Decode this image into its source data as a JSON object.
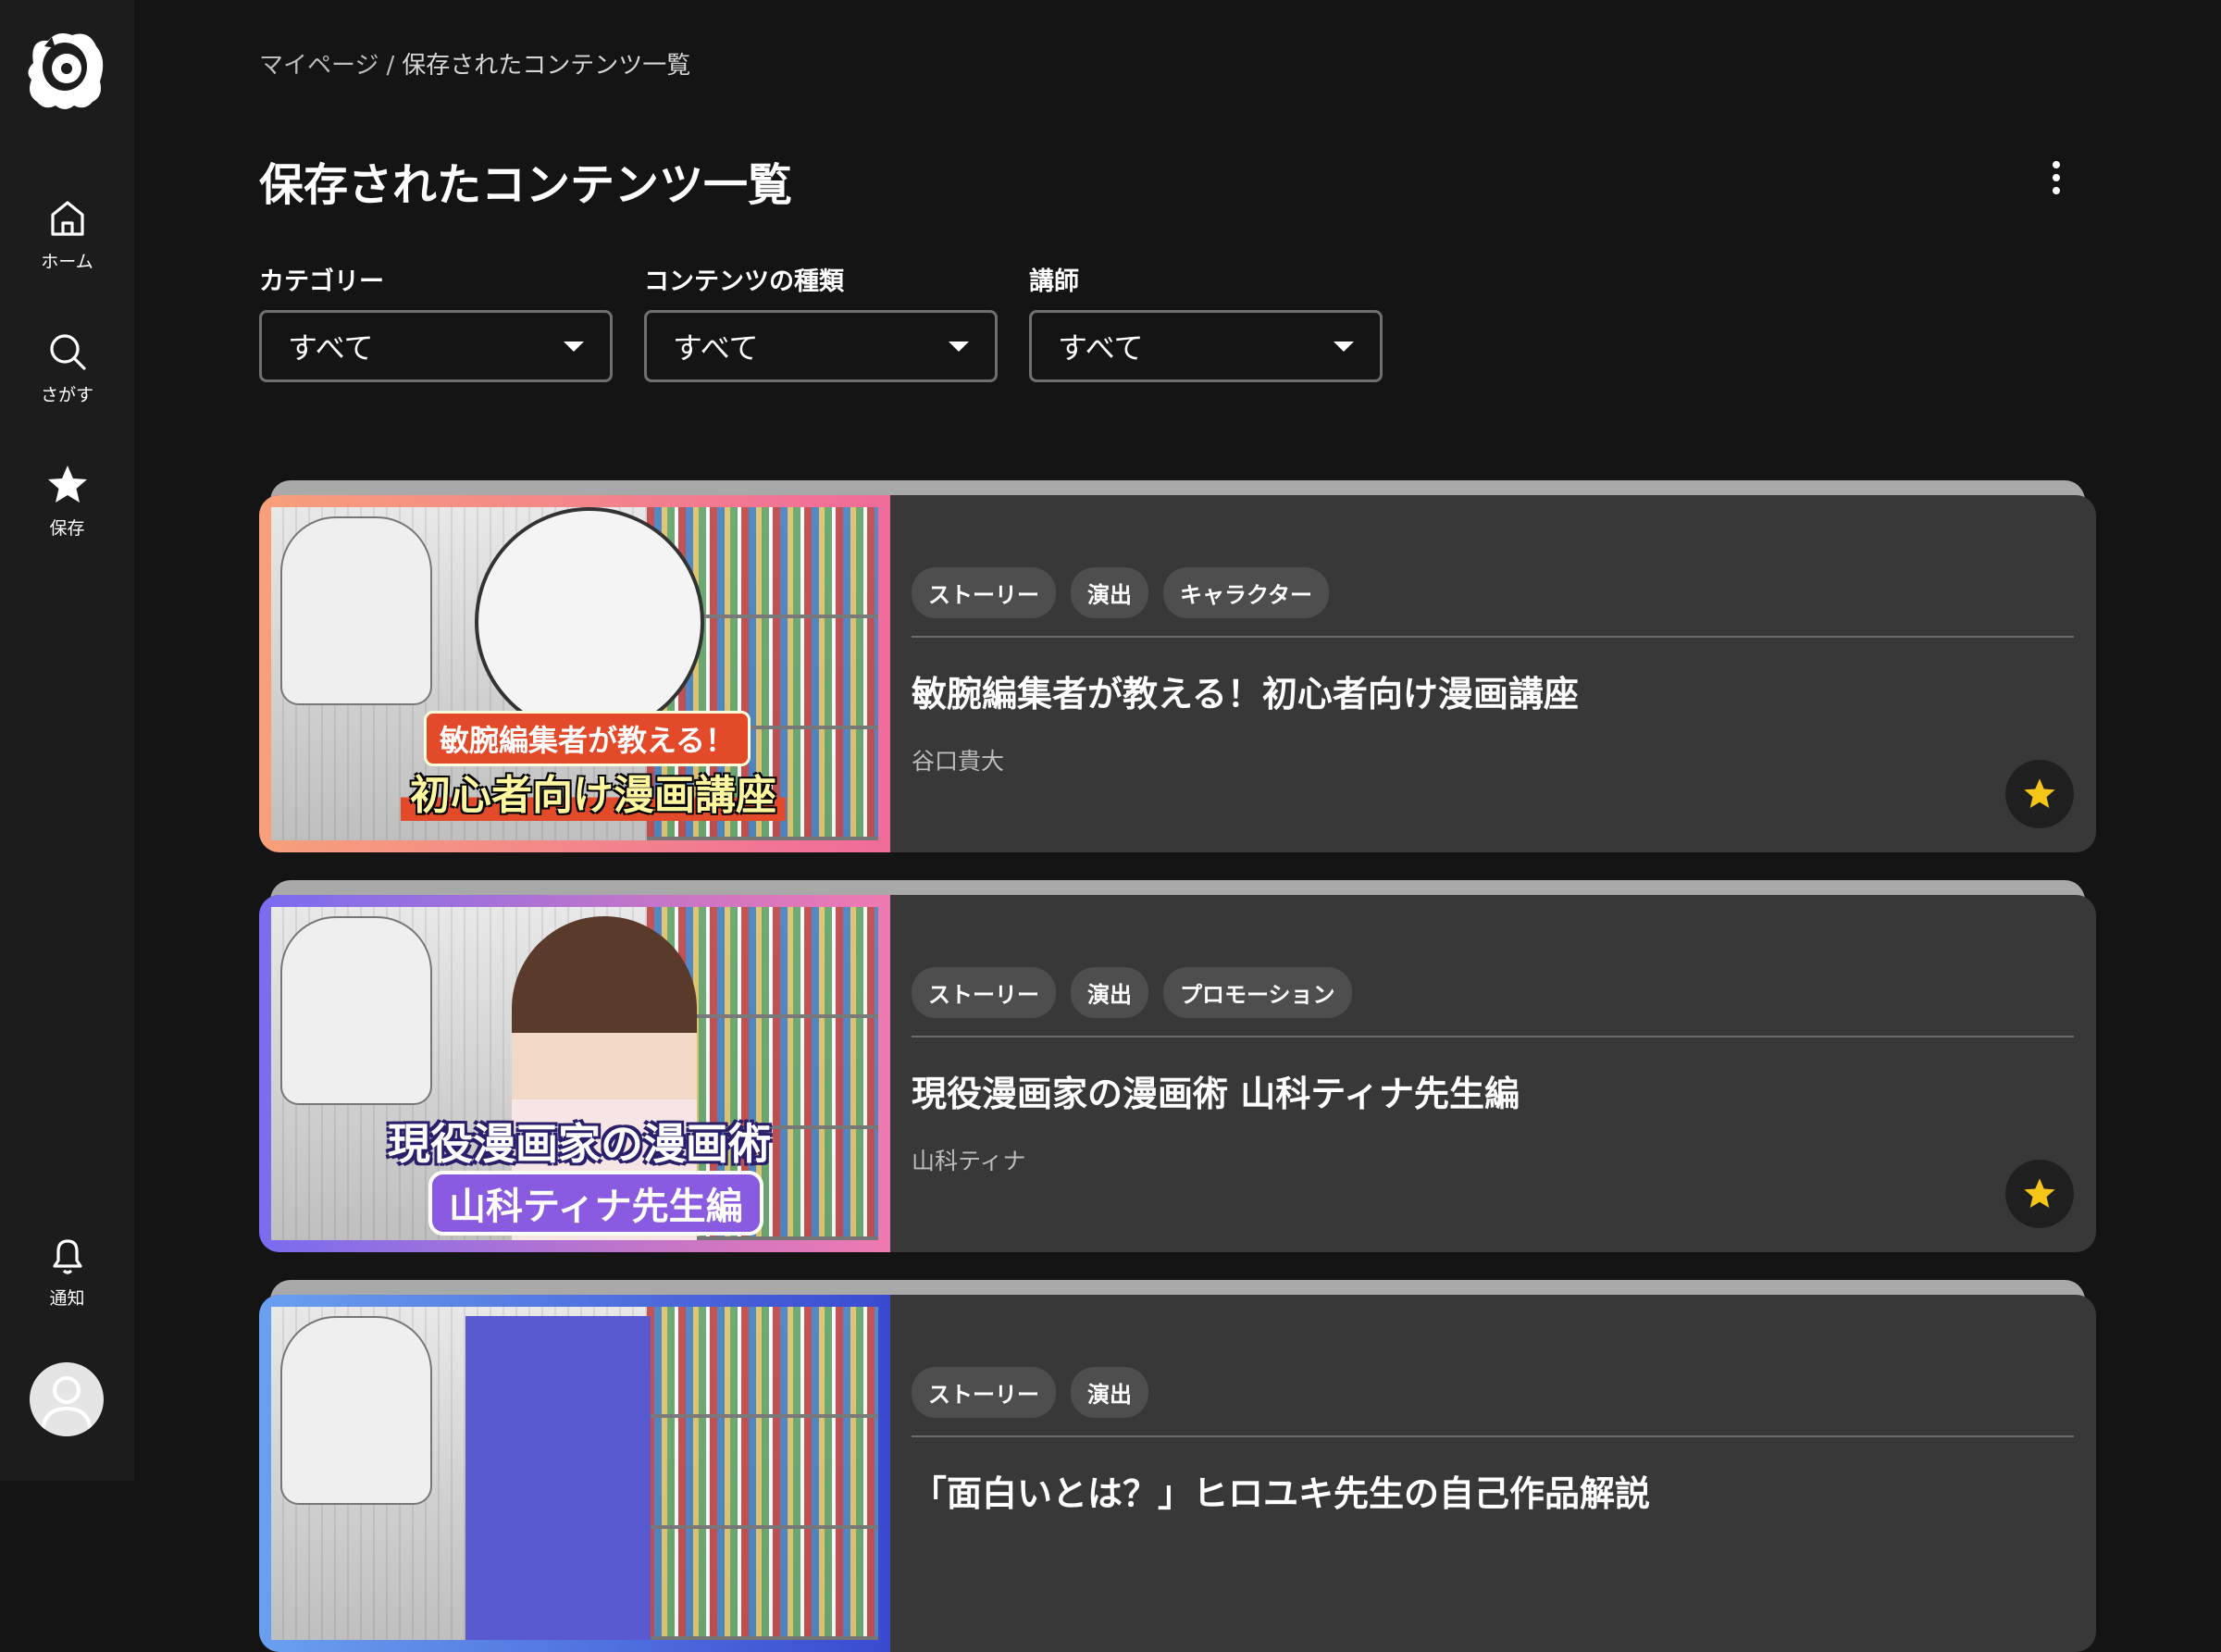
{
  "sidebar": {
    "home_label": "ホーム",
    "search_label": "さがす",
    "saved_label": "保存",
    "notify_label": "通知"
  },
  "breadcrumb": {
    "root": "マイページ",
    "separator": "/",
    "current": "保存されたコンテンツ一覧"
  },
  "page": {
    "title": "保存されたコンテンツ一覧"
  },
  "filters": [
    {
      "label": "カテゴリー",
      "value": "すべて"
    },
    {
      "label": "コンテンツの種類",
      "value": "すべて"
    },
    {
      "label": "講師",
      "value": "すべて"
    }
  ],
  "cards": [
    {
      "tags": [
        "ストーリー",
        "演出",
        "キャラクター"
      ],
      "title": "敏腕編集者が教える！初心者向け漫画講座",
      "teacher": "谷口貴大",
      "thumb_caption_top": "敏腕編集者が教える！",
      "thumb_caption_bottom": "初心者向け漫画講座",
      "border_gradient": [
        "#f7a07a",
        "#f06b9a"
      ]
    },
    {
      "tags": [
        "ストーリー",
        "演出",
        "プロモーション"
      ],
      "title": "現役漫画家の漫画術 山科ティナ先生編",
      "teacher": "山科ティナ",
      "thumb_caption_top": "現役漫画家の漫画術",
      "thumb_caption_bottom": "山科ティナ先生編",
      "border_gradient": [
        "#7a6cf0",
        "#f07ab0"
      ]
    },
    {
      "tags": [
        "ストーリー",
        "演出"
      ],
      "title": "「面白いとは？」ヒロユキ先生の自己作品解説",
      "teacher": "",
      "border_gradient": [
        "#6aa0f0",
        "#3a4ad0"
      ]
    }
  ],
  "colors": {
    "star": "#f5c518",
    "background": "#141414",
    "sidebar": "#1c1c1c",
    "card": "#383838"
  }
}
